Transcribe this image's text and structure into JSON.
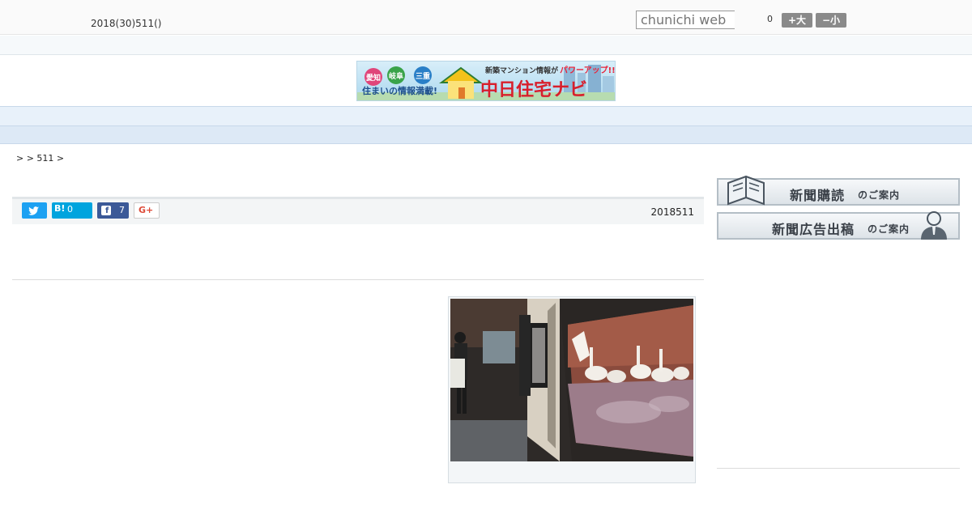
{
  "header": {
    "date": "2018(30)511()",
    "search_placeholder": "chunichi web",
    "count": "0",
    "font_larger_label": "+大",
    "font_smaller_label": "−小"
  },
  "banner": {
    "badges": [
      "愛知",
      "岐阜",
      "三重"
    ],
    "tagline": "住まいの情報満載!",
    "headline_prefix": "新築マンション情報が",
    "headline_highlight": "パワーアップ!!",
    "brand": "中日住宅ナビ"
  },
  "nav": {
    "items": [
      "　　",
      "　　",
      "　　",
      "　　",
      "　　",
      "　　",
      "　　",
      "　　",
      "　　"
    ]
  },
  "breadcrumb": ">  > 511 >",
  "share": {
    "hatena_label": "B!",
    "hatena_count": "0",
    "facebook_count": "7",
    "gplus_label": "G+",
    "date": "2018511"
  },
  "sidebar": {
    "subscribe_main": "新聞購読",
    "subscribe_suffix": "のご案内",
    "ad_main": "新聞広告出稿",
    "ad_suffix": "のご案内"
  },
  "colors": {
    "twitter": "#1da1f2",
    "hatena": "#00a4de",
    "facebook": "#3b5998",
    "nav_bg": "#e8f1fa"
  }
}
